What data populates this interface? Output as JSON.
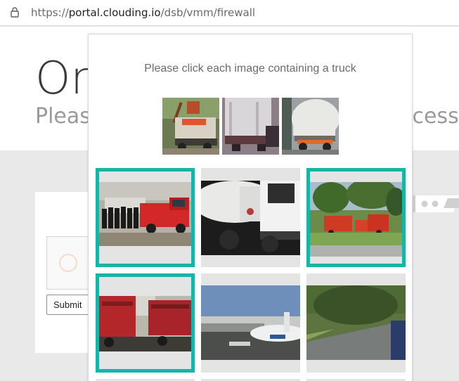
{
  "browser": {
    "url_prefix": "https://",
    "url_domain": "portal.clouding.io",
    "url_path": "/dsb/vmm/firewall",
    "lock_icon": "lock-icon"
  },
  "background_page": {
    "title_fragment": "On",
    "subtitle_fragment_left": "Please",
    "subtitle_fragment_right": "ccess",
    "submit_label": "Submit"
  },
  "challenge": {
    "prompt": "Please click each image containing a truck",
    "accent": "#17b4a8",
    "examples": [
      "orange-dump-truck",
      "white-box-truck",
      "white-tanker-truck"
    ],
    "tiles": [
      {
        "name": "tile-fire-truck-with-people",
        "selected": true
      },
      {
        "name": "tile-tanker-closeup",
        "selected": false
      },
      {
        "name": "tile-fire-trucks-on-grass",
        "selected": true
      },
      {
        "name": "tile-red-trucks-on-road",
        "selected": true
      },
      {
        "name": "tile-airplane-at-airport",
        "selected": false
      },
      {
        "name": "tile-blurry-road-scene",
        "selected": false
      }
    ]
  }
}
